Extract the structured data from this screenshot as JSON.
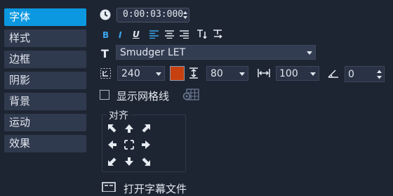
{
  "tabs": [
    {
      "label": "字体",
      "active": true
    },
    {
      "label": "样式",
      "active": false
    },
    {
      "label": "边框",
      "active": false
    },
    {
      "label": "阴影",
      "active": false
    },
    {
      "label": "背景",
      "active": false
    },
    {
      "label": "运动",
      "active": false
    },
    {
      "label": "效果",
      "active": false
    }
  ],
  "duration": {
    "value": "0:00:03:000"
  },
  "font": {
    "name": "Smudger LET"
  },
  "size": {
    "value": "240"
  },
  "color": {
    "swatch": "#c6410f"
  },
  "line_spacing": {
    "value": "80"
  },
  "char_spacing": {
    "value": "100"
  },
  "rotation": {
    "value": "0"
  },
  "gridlines": {
    "label": "显示网格线",
    "checked": false
  },
  "align": {
    "title": "对齐"
  },
  "open_subtitle": {
    "label": "打开字幕文件"
  },
  "colors": {
    "accent": "#0b98e0",
    "bg": "#1e2532",
    "control": "#2a3345"
  }
}
